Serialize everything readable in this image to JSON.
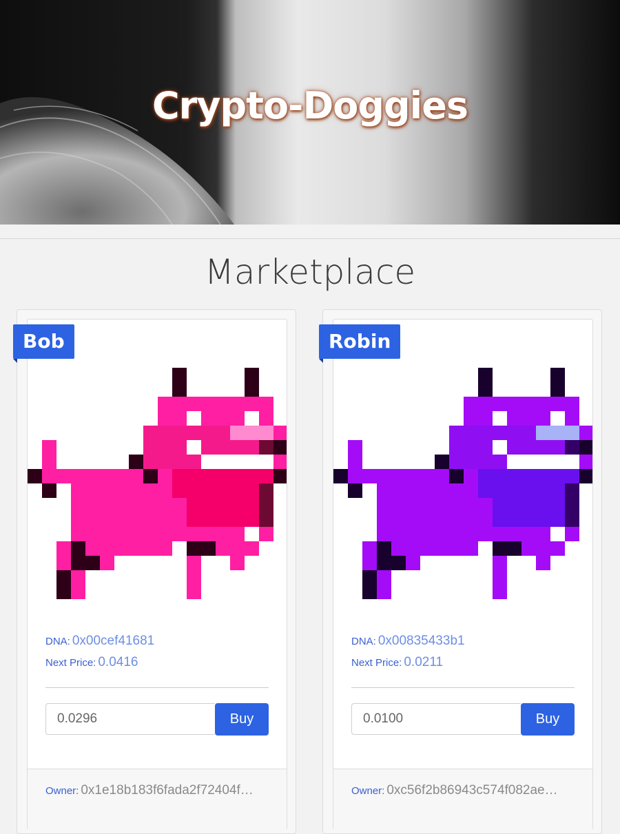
{
  "header": {
    "title": "Crypto-Doggies"
  },
  "marketplace": {
    "title": "Marketplace",
    "labels": {
      "dna": "DNA:",
      "next_price": "Next Price:",
      "owner": "Owner:",
      "buy": "Buy"
    },
    "cards": [
      {
        "name": "Bob",
        "dna": "0x00cef41681",
        "next_price": "0.0416",
        "price_input": "0.0296",
        "owner": "0x1e18b183f6fada2f72404f…",
        "colors": {
          "body": "#ff1fa3",
          "face": "#f51a8c",
          "chest": "#f5006a",
          "nose": "#ff8ad0",
          "dark": "#2e0018",
          "shade": "#6d0a33"
        }
      },
      {
        "name": "Robin",
        "dna": "0x00835433b1",
        "next_price": "0.0211",
        "price_input": "0.0100",
        "owner": "0xc56f2b86943c574f082ae…",
        "colors": {
          "body": "#a40cf7",
          "face": "#8f0ff2",
          "chest": "#6a10ee",
          "nose": "#a7b2f7",
          "dark": "#18012d",
          "shade": "#340067"
        }
      }
    ]
  }
}
